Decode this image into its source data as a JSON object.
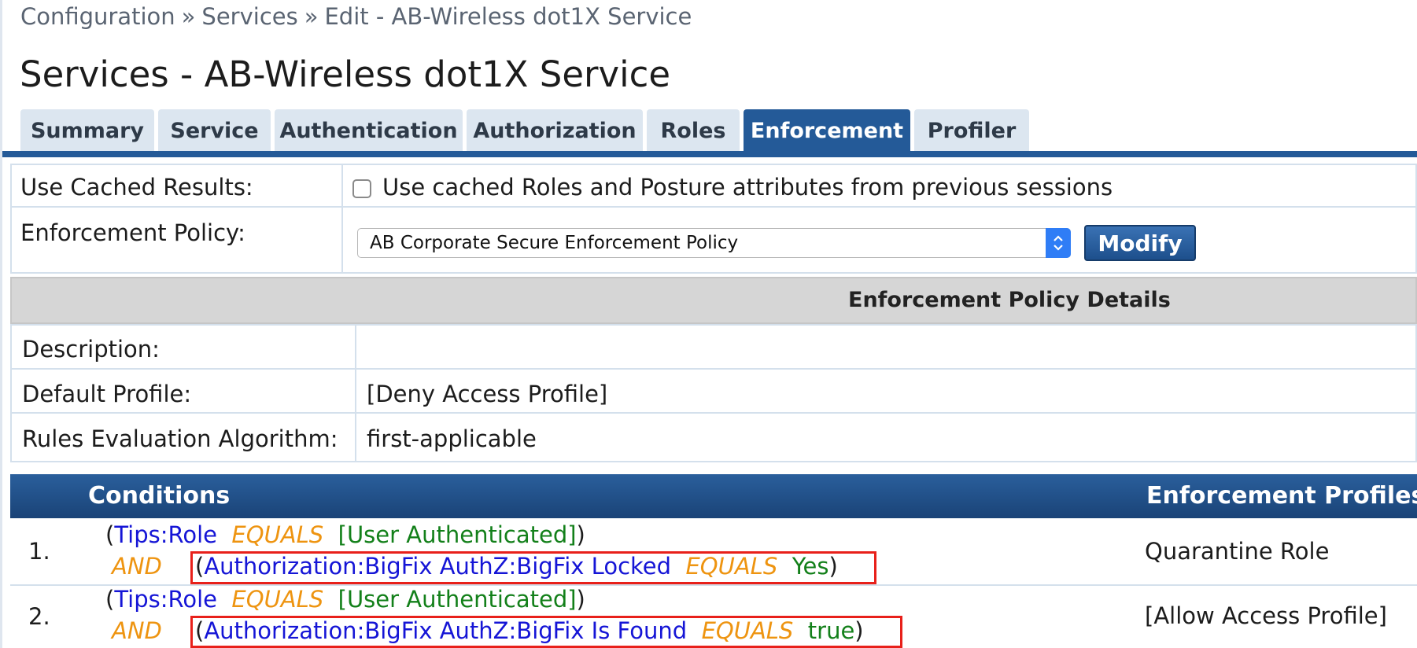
{
  "breadcrumb": {
    "items": [
      "Configuration",
      "Services",
      "Edit - AB-Wireless dot1X Service"
    ],
    "separator": "»"
  },
  "page_title": "Services - AB-Wireless dot1X Service",
  "tabs": [
    {
      "label": "Summary",
      "active": false
    },
    {
      "label": "Service",
      "active": false
    },
    {
      "label": "Authentication",
      "active": false
    },
    {
      "label": "Authorization",
      "active": false
    },
    {
      "label": "Roles",
      "active": false
    },
    {
      "label": "Enforcement",
      "active": true
    },
    {
      "label": "Profiler",
      "active": false
    }
  ],
  "form": {
    "cached_label": "Use Cached Results:",
    "cached_checkbox_label": "Use cached Roles and Posture attributes from previous sessions",
    "cached_checked": false,
    "policy_label": "Enforcement Policy:",
    "policy_selected": "AB Corporate Secure Enforcement Policy",
    "modify_label": "Modify"
  },
  "details": {
    "title": "Enforcement Policy Details",
    "rows": [
      {
        "label": "Description:",
        "value": ""
      },
      {
        "label": "Default Profile:",
        "value": "[Deny Access Profile]"
      },
      {
        "label": "Rules Evaluation Algorithm:",
        "value": "first-applicable"
      }
    ]
  },
  "rules": {
    "headers": {
      "conditions": "Conditions",
      "profiles": "Enforcement Profiles"
    },
    "items": [
      {
        "num": "1.",
        "line1": {
          "open": "(",
          "attr": "Tips:Role",
          "op": "EQUALS",
          "value": "[User Authenticated]",
          "close": ")"
        },
        "line2": {
          "conj": "AND",
          "open": "(",
          "attr": "Authorization:BigFix AuthZ:BigFix Locked",
          "op": "EQUALS",
          "value": "Yes",
          "close": ")"
        },
        "profile": "Quarantine Role"
      },
      {
        "num": "2.",
        "line1": {
          "open": "(",
          "attr": "Tips:Role",
          "op": "EQUALS",
          "value": "[User Authenticated]",
          "close": ")"
        },
        "line2": {
          "conj": "AND",
          "open": "(",
          "attr": "Authorization:BigFix AuthZ:BigFix Is Found",
          "op": "EQUALS",
          "value": "true",
          "close": ")"
        },
        "profile": "[Allow Access Profile]"
      }
    ]
  },
  "colors": {
    "accent": "#245a98",
    "tab_bg": "#dce6f0",
    "attribute": "#1515d6",
    "operator": "#ee9410",
    "value": "#13801a",
    "highlight": "#e8201a"
  },
  "icons": {
    "select_arrow": "chevron-up-down-icon"
  }
}
